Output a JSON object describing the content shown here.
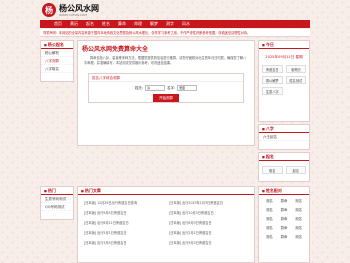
{
  "header": {
    "logo_char": "杨",
    "site_name": "杨公风水网",
    "site_url": "WWW.YGFSW.COM"
  },
  "nav": [
    "首页",
    "黄历",
    "起名",
    "姓名",
    "算命",
    "命理",
    "解梦",
    "测字",
    "风水"
  ],
  "notice": "郑重声明：本网站的全量内容来源于国内本地传统文化思想及杨公风水理论，仅作学习参考之用，不作严谨性判断参考依据，谨慎迷信请理性对待。",
  "sidebar": {
    "title": "杨公起名",
    "items": [
      "杨公解析",
      "八字测算",
      "八字取名"
    ],
    "active_index": 1,
    "bottom_title": "热门",
    "bottom_items": [
      "生辰号码测试",
      "QQ号码测试"
    ]
  },
  "main": {
    "title": "杨公风水网免费算命大全",
    "intro": "算命包括八卦、星象等多种方法，根据您提供的信息进行推算，请您仔细核对出生的年月日时辰，确保您了解八字命理，并准确填写，本站测试仅供娱乐参考，切勿迷信结果。",
    "form": {
      "title": "姓名八字综合测算",
      "surname_label": "姓氏:",
      "surname_value": "冷",
      "name_label": "名字:",
      "name_value": "忠臣",
      "submit_label": "开始测算"
    },
    "hot_title": "热门文章",
    "hot_items": [
      "[日本版] 12月29日出行黄道吉日查询",
      "[日本版] 出行2023年1月3日黄道吉日",
      "[日本版] 出行9月5日黄道吉日",
      "[日本版] 出行10月3日黄道吉日",
      "[日本版] 出行6月11日黄道吉日",
      "[日本版] 出行6月3日黄道吉日",
      "[日本版] 出行5月1日黄道吉日",
      "[日本版] 出行2月1日黄道吉日",
      "[日本版] 出行3月5日黄道吉日",
      "[日本版] 出行9月3日黄道吉日"
    ]
  },
  "right": {
    "date_title": "今日",
    "date_text": "2025年09月11日 星期",
    "buttons": [
      "黄道吉日",
      "老黄历",
      "周公解梦",
      "姓名测试",
      "生辰八字"
    ],
    "links_title": "八字",
    "links": [
      "六壬起名"
    ],
    "names_title": "起名",
    "names_row": [
      "取名",
      "起名"
    ],
    "grid_title": "姓名配对",
    "grid_items": [
      "测名",
      "算命",
      "测名",
      "测名",
      "算命",
      "测名",
      "测名",
      "算命",
      "测名",
      "测名",
      "算命",
      "测名",
      "测名",
      "算命",
      "测名"
    ]
  }
}
